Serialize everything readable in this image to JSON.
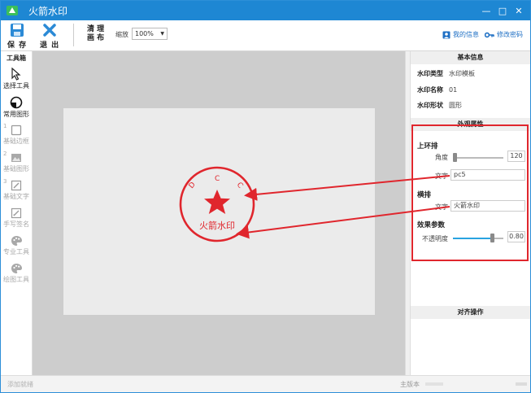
{
  "window": {
    "title": "火箭水印",
    "controls": [
      "—",
      "□",
      "✕"
    ]
  },
  "toolbar": {
    "save_label": "保 存",
    "exit_label": "退 出",
    "clear_line1": "清 理",
    "clear_line2": "画 布",
    "zoom_label": "缩放",
    "zoom_value": "100%",
    "my_info_label": "我的信息",
    "change_password_label": "修改密码"
  },
  "toolbox": {
    "title": "工具箱",
    "items": [
      {
        "label": "选择工具",
        "icon": "cursor-icon"
      },
      {
        "label": "常用图形",
        "icon": "circle-shape-icon"
      },
      {
        "label": "基础边框",
        "icon": "square-icon",
        "step": "1"
      },
      {
        "label": "基础图形",
        "icon": "image-icon",
        "step": "2"
      },
      {
        "label": "基础文字",
        "icon": "edit-icon",
        "step": "3"
      },
      {
        "label": "手写签名",
        "icon": "pen-icon"
      },
      {
        "label": "专业工具",
        "icon": "palette-icon"
      },
      {
        "label": "绘图工具",
        "icon": "palette-icon"
      }
    ]
  },
  "stamp": {
    "arc_letters": [
      "D",
      "C",
      "C"
    ],
    "center_text": "火箭水印",
    "color": "#e0262d"
  },
  "panel": {
    "basic_info_header": "基本信息",
    "info": [
      {
        "key": "水印类型",
        "value": "水印模板"
      },
      {
        "key": "水印名称",
        "value": "01"
      },
      {
        "key": "水印形状",
        "value": "圆形"
      }
    ],
    "appearance_header": "外观属性",
    "ring_title": "上环排",
    "angle_label": "角度",
    "angle_value": "120",
    "angle_fraction": 0.0,
    "ring_text_label": "文字",
    "ring_text_value": "pc5",
    "horizontal_title": "横排",
    "horiz_text_label": "文字",
    "horiz_text_value": "火箭水印",
    "effects_title": "效果参数",
    "opacity_label": "不透明度",
    "opacity_value": "0.80",
    "opacity_fraction": 0.8,
    "align_header": "对齐操作"
  },
  "statusbar": {
    "left_text": "添加就绪",
    "version_text": "主版本"
  },
  "colors": {
    "titlebar": "#1e87d3",
    "accent": "#e0262d",
    "link": "#1e6fc4"
  }
}
